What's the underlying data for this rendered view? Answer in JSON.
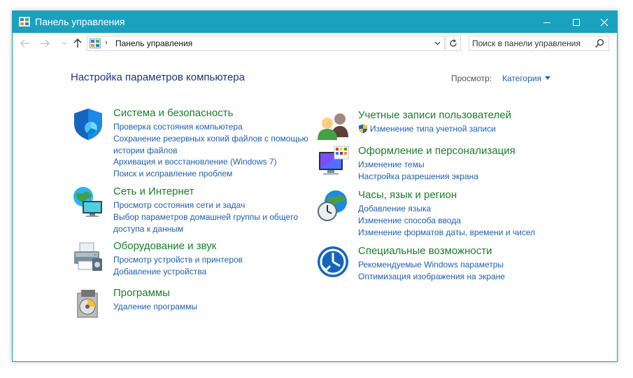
{
  "window": {
    "title": "Панель управления"
  },
  "address": {
    "crumb": "Панель управления"
  },
  "search": {
    "placeholder": "Поиск в панели управления"
  },
  "main": {
    "heading": "Настройка параметров компьютера",
    "view_label": "Просмотр:",
    "view_value": "Категория"
  },
  "categories": {
    "system": {
      "title": "Система и безопасность",
      "links": [
        "Проверка состояния компьютера",
        "Сохранение резервных копий файлов с помощью",
        "истории файлов",
        "Архивация и восстановление (Windows 7)",
        "Поиск и исправление проблем"
      ]
    },
    "network": {
      "title": "Сеть и Интернет",
      "links": [
        "Просмотр состояния сети и задач",
        "Выбор параметров домашней группы и общего",
        "доступа к данным"
      ]
    },
    "hardware": {
      "title": "Оборудование и звук",
      "links": [
        "Просмотр устройств и принтеров",
        "Добавление устройства"
      ]
    },
    "programs": {
      "title": "Программы",
      "links": [
        "Удаление программы"
      ]
    },
    "users": {
      "title": "Учетные записи пользователей",
      "links": [
        "Изменение типа учетной записи"
      ]
    },
    "appearance": {
      "title": "Оформление и персонализация",
      "links": [
        "Изменение темы",
        "Настройка разрешения экрана"
      ]
    },
    "clock": {
      "title": "Часы, язык и регион",
      "links": [
        "Добавление языка",
        "Изменение способа ввода",
        "Изменение форматов даты, времени и чисел"
      ]
    },
    "access": {
      "title": "Специальные возможности",
      "links": [
        "Рекомендуемые Windows параметры",
        "Оптимизация изображения на экране"
      ]
    }
  },
  "colors": {
    "titlebar": "#1aa1bd",
    "category_title": "#1a7f2a",
    "link": "#1f5fb0",
    "heading": "#1e3287"
  },
  "icons": {
    "system": "security-shield-icon",
    "network": "globe-network-icon",
    "hardware": "printer-icon",
    "programs": "programs-disc-icon",
    "users": "users-icon",
    "appearance": "monitor-palette-icon",
    "clock": "clock-globe-icon",
    "access": "accessibility-icon"
  }
}
